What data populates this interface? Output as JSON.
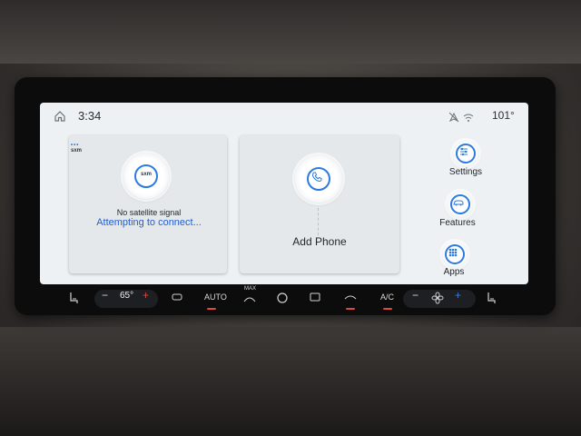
{
  "status": {
    "time": "3:34",
    "temperature": "101°",
    "icons": [
      "home-icon",
      "no-location-icon",
      "wifi-icon"
    ]
  },
  "radio_card": {
    "logo": "sxm",
    "signal_text": "No satellite signal",
    "connect_text": "Attempting to connect..."
  },
  "phone_card": {
    "label": "Add Phone"
  },
  "side_menu": {
    "settings": "Settings",
    "features": "Features",
    "apps": "Apps"
  },
  "climate": {
    "driver_temp": "65°",
    "minus": "−",
    "plus": "+",
    "auto_label": "AUTO",
    "max_label": "MAX",
    "ac_label": "A/C"
  },
  "colors": {
    "accent_blue": "#2d7be0",
    "link_blue": "#1f5fd1",
    "screen_bg": "#eef1f3",
    "red_indicator": "#e0483c"
  }
}
